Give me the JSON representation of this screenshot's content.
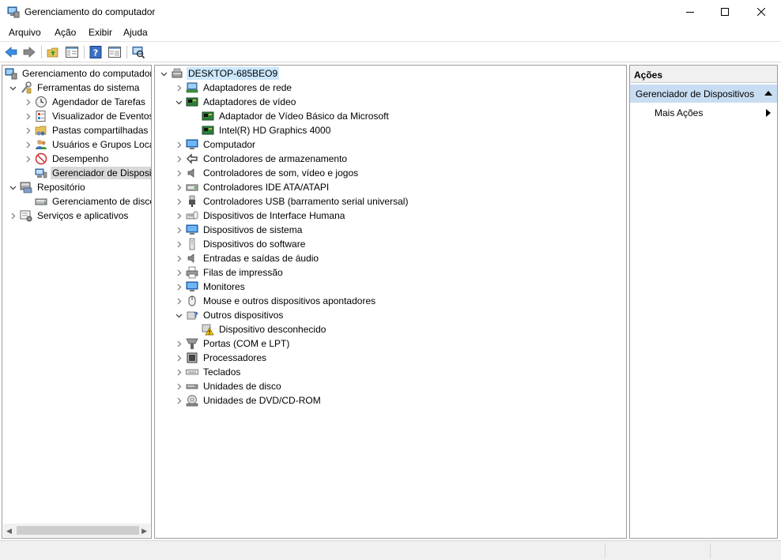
{
  "window": {
    "title": "Gerenciamento do computador",
    "controls": [
      "minimize",
      "maximize",
      "close"
    ]
  },
  "menu": [
    "Arquivo",
    "Ação",
    "Exibir",
    "Ajuda"
  ],
  "toolbar": {
    "buttons": [
      "back-icon",
      "forward-icon",
      "up-folder-icon",
      "show-hide-tree-icon",
      "help-icon",
      "properties-icon",
      "scan-hardware-icon"
    ]
  },
  "left_tree": {
    "root": "Gerenciamento do computador (Local)",
    "system_tools": "Ferramentas do sistema",
    "task_scheduler": "Agendador de Tarefas",
    "event_viewer": "Visualizador de Eventos",
    "shared_folders": "Pastas compartilhadas",
    "local_users": "Usuários e Grupos Locais",
    "performance": "Desempenho",
    "device_manager": "Gerenciador de Dispositivos",
    "storage": "Repositório",
    "disk_management": "Gerenciamento de disco",
    "services": "Serviços e aplicativos"
  },
  "device_tree": {
    "computer_name": "DESKTOP-685BEO9",
    "network_adapters": "Adaptadores de rede",
    "display_adapters": "Adaptadores de vídeo",
    "display_child_1": "Adaptador de Vídeo Básico da Microsoft",
    "display_child_2": "Intel(R) HD Graphics 4000",
    "computer": "Computador",
    "storage_controllers": "Controladores de armazenamento",
    "sound_controllers": "Controladores de som, vídeo e jogos",
    "ide_controllers": "Controladores IDE ATA/ATAPI",
    "usb_controllers": "Controladores USB (barramento serial universal)",
    "hid": "Dispositivos de Interface Humana",
    "system_devices": "Dispositivos de sistema",
    "software_devices": "Dispositivos do software",
    "audio_io": "Entradas e saídas de áudio",
    "print_queues": "Filas de impressão",
    "monitors": "Monitores",
    "mice": "Mouse e outros dispositivos apontadores",
    "other_devices": "Outros dispositivos",
    "unknown_device": "Dispositivo desconhecido",
    "ports": "Portas (COM e LPT)",
    "processors": "Processadores",
    "keyboards": "Teclados",
    "disk_drives": "Unidades de disco",
    "dvd_drives": "Unidades de DVD/CD-ROM"
  },
  "actions": {
    "header": "Ações",
    "section": "Gerenciador de Dispositivos",
    "more": "Mais Ações"
  },
  "colors": {
    "selection": "#cce8ff",
    "actions_section_bg": "#c8ddf2",
    "border": "#9c9c9c"
  }
}
